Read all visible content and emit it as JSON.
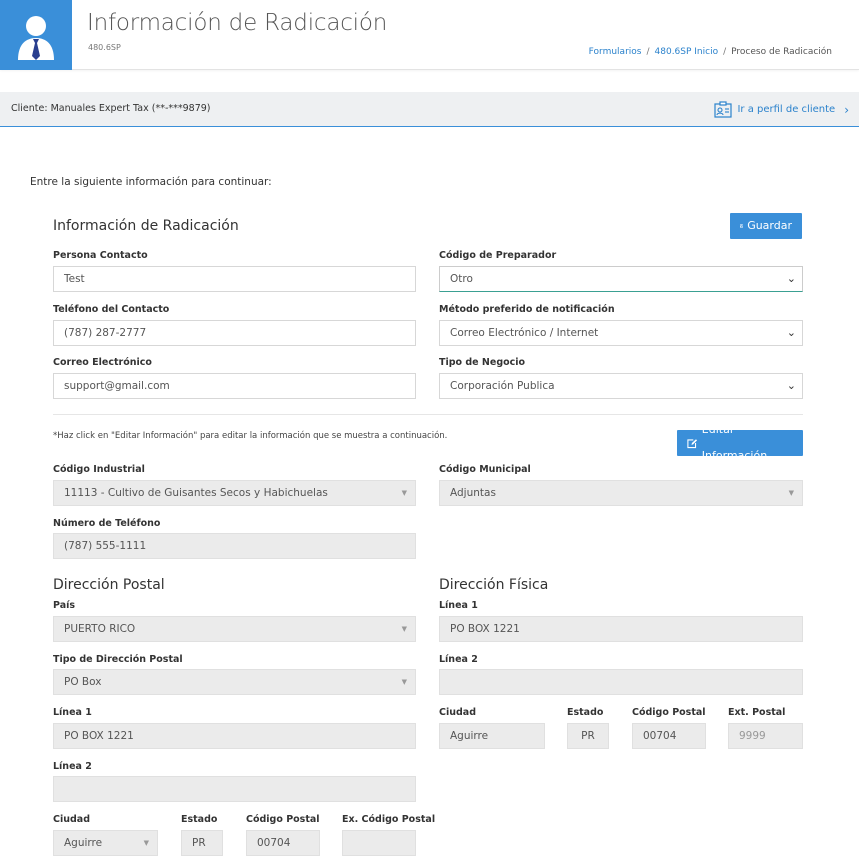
{
  "header": {
    "title": "Información de Radicación",
    "subtitle": "480.6SP",
    "breadcrumb": {
      "item1": "Formularios",
      "item2": "480.6SP Inicio",
      "item3": "Proceso de Radicación",
      "sep": "/"
    }
  },
  "client_bar": {
    "client_text": "Cliente: Manuales Expert Tax (**-***9879)",
    "profile_link": "Ir a perfil de cliente"
  },
  "intro": "Entre la siguiente información para continuar:",
  "form": {
    "section_title": "Información de Radicación",
    "save_label": "Guardar",
    "contact_person_label": "Persona Contacto",
    "contact_person_value": "Test",
    "preparer_code_label": "Código de Preparador",
    "preparer_code_value": "Otro",
    "contact_phone_label": "Teléfono del Contacto",
    "contact_phone_value": "(787) 287-2777",
    "notification_label": "Método preferido de notificación",
    "notification_value": "Correo Electrónico / Internet",
    "email_label": "Correo Electrónico",
    "email_value": "support@gmail.com",
    "business_type_label": "Tipo de Negocio",
    "business_type_value": "Corporación Publica"
  },
  "readonly": {
    "note": "*Haz click en \"Editar Información\" para editar la información que se muestra a continuación.",
    "edit_label": "Editar Información",
    "industrial_code_label": "Código Industrial",
    "industrial_code_value": "11113 - Cultivo de Guisantes Secos y Habichuelas",
    "municipal_code_label": "Código Municipal",
    "municipal_code_value": "Adjuntas",
    "phone_label": "Número de Teléfono",
    "phone_value": "(787) 555-1111"
  },
  "postal": {
    "title": "Dirección Postal",
    "country_label": "País",
    "country_value": "PUERTO RICO",
    "address_type_label": "Tipo de Dirección Postal",
    "address_type_value": "PO Box",
    "line1_label": "Línea 1",
    "line1_value": "PO BOX 1221",
    "line2_label": "Línea 2",
    "line2_value": "",
    "city_label": "Ciudad",
    "city_value": "Aguirre",
    "state_label": "Estado",
    "state_value": "PR",
    "zip_label": "Código Postal",
    "zip_value": "00704",
    "zip_ext_label": "Ex. Código Postal",
    "zip_ext_value": ""
  },
  "physical": {
    "title": "Dirección Física",
    "line1_label": "Línea 1",
    "line1_value": "PO BOX 1221",
    "line2_label": "Línea 2",
    "line2_value": "",
    "city_label": "Ciudad",
    "city_value": "Aguirre",
    "state_label": "Estado",
    "state_value": "PR",
    "zip_label": "Código Postal",
    "zip_value": "00704",
    "zip_ext_label": "Ext. Postal",
    "zip_ext_value": "9999"
  },
  "colors": {
    "accent": "#3a8fd9",
    "link": "#2b82cc"
  }
}
